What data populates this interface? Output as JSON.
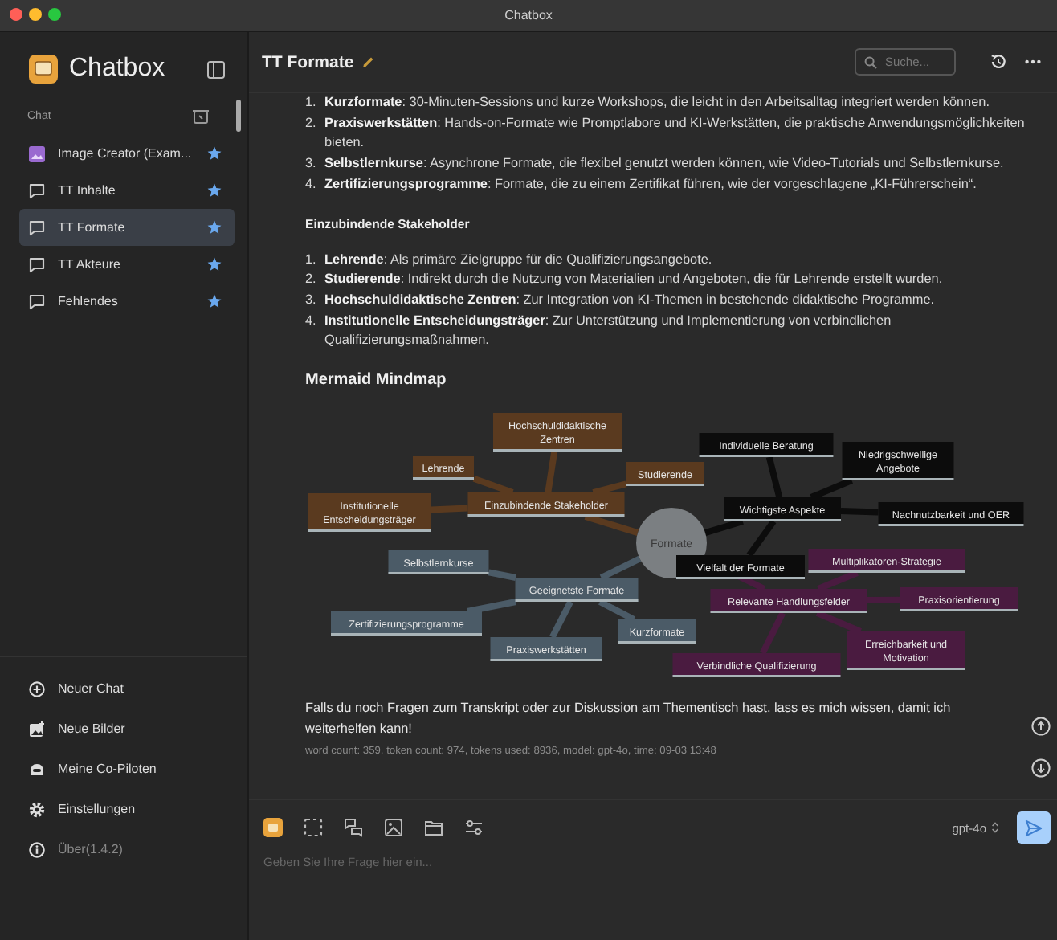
{
  "window": {
    "title": "Chatbox"
  },
  "sidebar": {
    "app_name": "Chatbox",
    "section_label": "Chat",
    "chats": [
      {
        "label": "Image Creator (Exam...",
        "kind": "image",
        "starred": true,
        "selected": false
      },
      {
        "label": "TT Inhalte",
        "kind": "chat",
        "starred": true,
        "selected": false
      },
      {
        "label": "TT Formate",
        "kind": "chat",
        "starred": true,
        "selected": true
      },
      {
        "label": "TT Akteure",
        "kind": "chat",
        "starred": true,
        "selected": false
      },
      {
        "label": "Fehlendes",
        "kind": "chat",
        "starred": true,
        "selected": false
      }
    ],
    "menu": [
      {
        "label": "Neuer Chat",
        "kind": "new-chat"
      },
      {
        "label": "Neue Bilder",
        "kind": "images"
      },
      {
        "label": "Meine Co-Piloten",
        "kind": "copilots"
      },
      {
        "label": "Einstellungen",
        "kind": "settings"
      },
      {
        "label": "Über(1.4.2)",
        "kind": "about"
      }
    ]
  },
  "header": {
    "title": "TT Formate",
    "search": {
      "placeholder": "Suche..."
    }
  },
  "content": {
    "list_1": [
      {
        "number": "1.",
        "text": "**Kurzformate**: 30-Minuten-Sessions und kurze Workshops, die leicht in den Arbeitsalltag integriert werden können."
      },
      {
        "number": "2.",
        "text": "**Praxiswerkstätten**: Hands-on-Formate wie Promptlabore und KI-Werkstätten, die praktische Anwendungsmöglichkeiten bieten."
      },
      {
        "number": "3.",
        "text": "**Selbstlernkurse**: Asynchrone Formate, die flexibel genutzt werden können, wie Video-Tutorials und Selbstlernkurse."
      },
      {
        "number": "4.",
        "text": "**Zertifizierungsprogramme**: Formate, die zu einem Zertifikat führen, wie der vorgeschlagene „KI-Führerschein“."
      }
    ],
    "heading": "Einzubindende Stakeholder",
    "list_2": [
      {
        "number": "1.",
        "text": "**Lehrende**: Als primäre Zielgruppe für die Qualifizierungsangebote."
      },
      {
        "number": "2.",
        "text": "**Studierende**: Indirekt durch die Nutzung von Materialien und Angeboten, die für Lehrende erstellt wurden."
      },
      {
        "number": "3.",
        "text": "**Hochschuldidaktische Zentren**: Zur Integration von KI-Themen in bestehende didaktische Programme."
      },
      {
        "number": "4.",
        "text": "**Institutionelle Entscheidungsträger**: Zur Unterstützung und Implementierung von verbindlichen Qualifizierungsmaßnahmen."
      }
    ],
    "mindmap_title": "Mermaid Mindmap",
    "mindmap": {
      "root": "Formate",
      "branches": [
        {
          "label": "Einzubindende Stakeholder",
          "color": "#5a3a1f",
          "children": [
            {
              "label": "Hochschuldidaktische Zentren"
            },
            {
              "label": "Lehrende"
            },
            {
              "label": "Studierende"
            },
            {
              "label": "Institutionelle Entscheidungsträger"
            }
          ]
        },
        {
          "label": "Wichtigste Aspekte",
          "color": "#0c0c0c",
          "children": [
            {
              "label": "Individuelle Beratung"
            },
            {
              "label": "Niedrigschwellige Angebote"
            },
            {
              "label": "Nachnutzbarkeit und OER"
            },
            {
              "label": "Vielfalt der Formate"
            }
          ]
        },
        {
          "label": "Geeignetste Formate",
          "color": "#4b5b67",
          "children": [
            {
              "label": "Selbstlernkurse"
            },
            {
              "label": "Zertifizierungsprogramme"
            },
            {
              "label": "Praxiswerkstätten"
            },
            {
              "label": "Kurzformate"
            }
          ]
        },
        {
          "label": "Relevante Handlungsfelder",
          "color": "#4a1b40",
          "children": [
            {
              "label": "Multiplikatoren-Strategie"
            },
            {
              "label": "Praxisorientierung"
            },
            {
              "label": "Erreichbarkeit und Motivation"
            },
            {
              "label": "Verbindliche Qualifizierung"
            }
          ]
        }
      ]
    },
    "closing": "Falls du noch Fragen zum Transkript oder zur Diskussion am Thementisch hast, lass es mich wissen, damit ich weiterhelfen kann!",
    "meta": "word count: 359, token count: 974, tokens used: 8936, model: gpt-4o, time: 09-03 13:48"
  },
  "composer": {
    "model": "gpt-4o",
    "placeholder": "Geben Sie Ihre Frage hier ein..."
  }
}
